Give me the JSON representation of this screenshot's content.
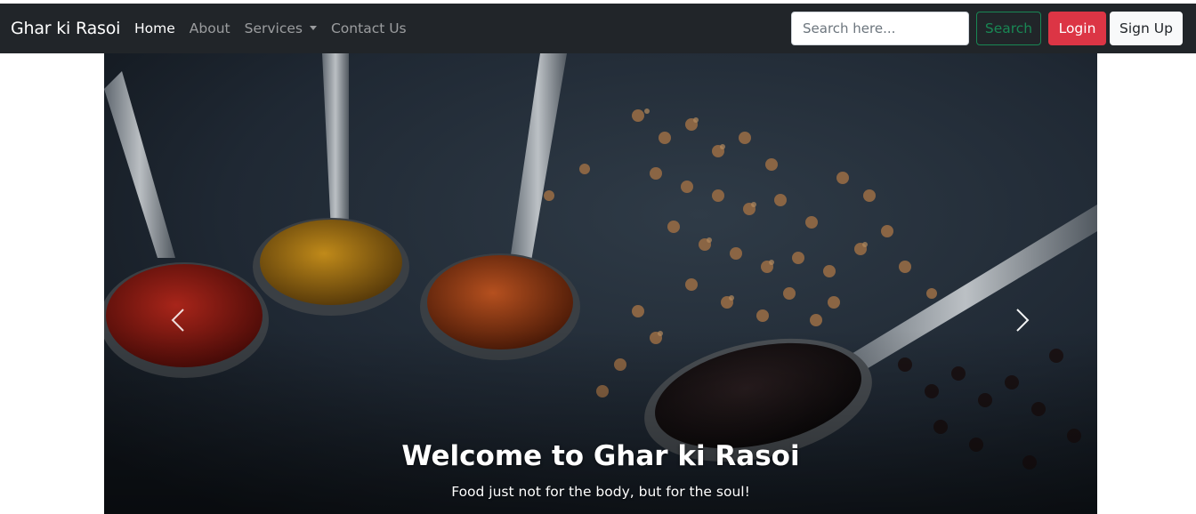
{
  "brand": "Ghar ki Rasoi",
  "nav": {
    "items": [
      {
        "label": "Home",
        "active": true
      },
      {
        "label": "About"
      },
      {
        "label": "Services",
        "dropdown": true
      },
      {
        "label": "Contact Us"
      }
    ]
  },
  "search": {
    "placeholder": "Search here...",
    "button": "Search"
  },
  "auth": {
    "login": "Login",
    "signup": "Sign Up"
  },
  "carousel": {
    "title": "Welcome to Ghar ki Rasoi",
    "text": "Food just not for the body, but for the soul!",
    "prev_icon": "chevron-left-icon",
    "next_icon": "chevron-right-icon"
  },
  "colors": {
    "navbar": "#212529",
    "search_button": "#198754",
    "login_button": "#dc3545",
    "signup_button": "#f8f9fa"
  }
}
